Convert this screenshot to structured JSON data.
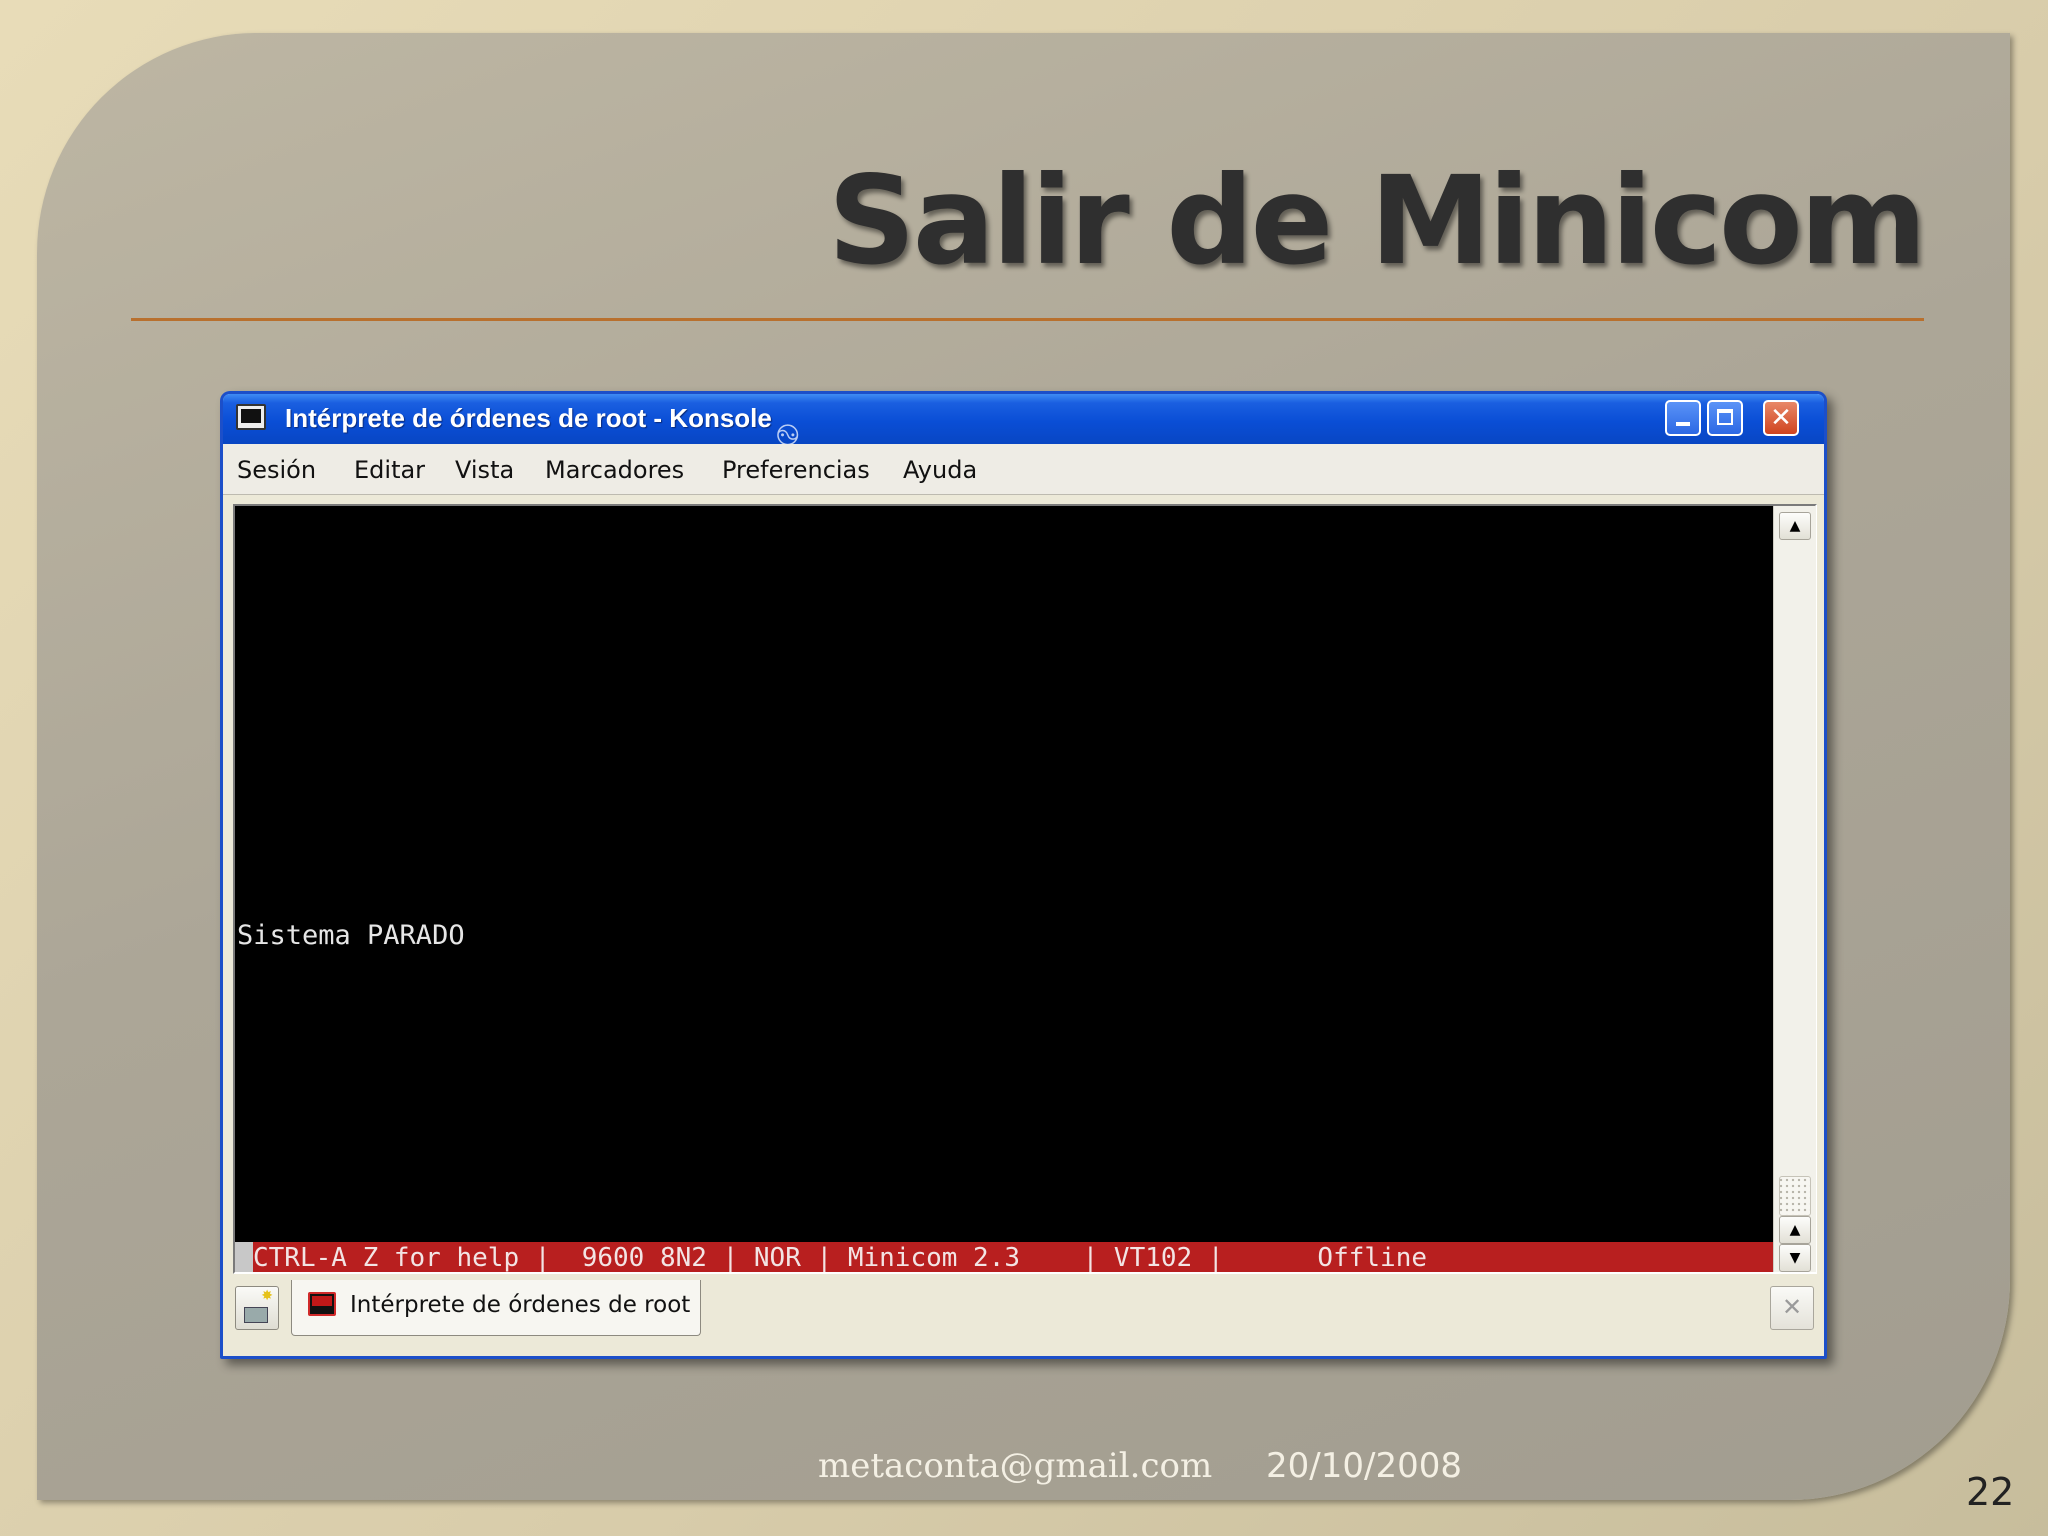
{
  "slide": {
    "title": "Salir de Minicom",
    "footer_email": "metaconta@gmail.com",
    "footer_date": "20/10/2008",
    "page_number": "22",
    "accent_rule_color": "#b8702e"
  },
  "window": {
    "title": "Intérprete de órdenes de root - Konsole",
    "title_icon": "konsole-terminal-icon",
    "decoration_icon": "swirl-icon",
    "controls": [
      "minimize",
      "maximize",
      "close"
    ],
    "titlebar_color": "#0a4ed6"
  },
  "menubar": {
    "items": [
      "Sesión",
      "Editar",
      "Vista",
      "Marcadores",
      "Preferencias",
      "Ayuda"
    ]
  },
  "terminal": {
    "output_line": "Sistema PARADO",
    "status_line": "CTRL-A Z for help |  9600 8N2 | NOR | Minicom 2.3    | VT102 |      Offline",
    "status_color": "#b81f1f"
  },
  "scrollbar": {
    "up_glyph": "▲",
    "down_glyph": "▼"
  },
  "tabbar": {
    "tabs": [
      {
        "label": "Intérprete de órdenes de root",
        "icon": "terminal-tab-icon"
      }
    ],
    "new_tab_icon": "new-session-icon",
    "close_tab_icon": "close-session-icon",
    "close_glyph": "✕"
  }
}
